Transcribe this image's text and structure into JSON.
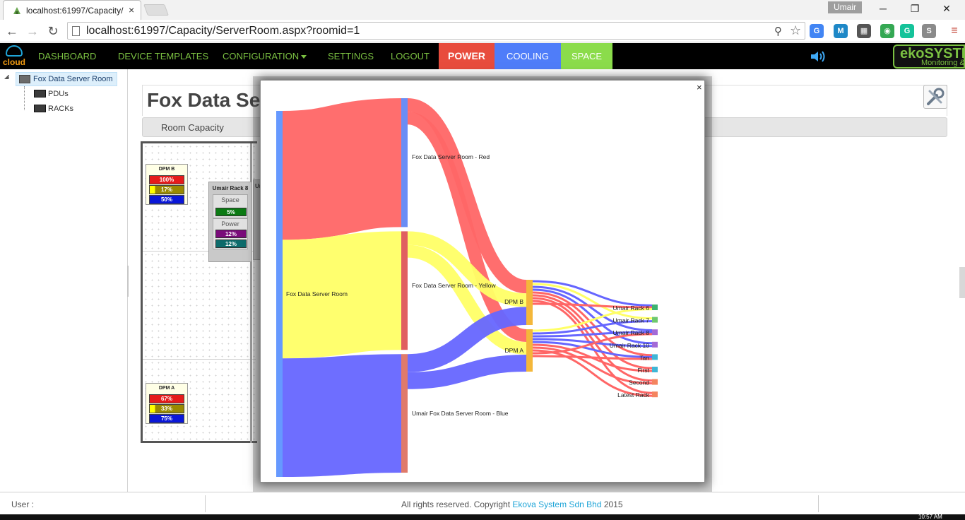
{
  "browser": {
    "tab_title": "localhost:61997/Capacity/",
    "tab_close": "×",
    "profile_name": "Umair",
    "url": "localhost:61997/Capacity/ServerRoom.aspx?roomid=1",
    "icons": [
      "back-icon",
      "forward-icon",
      "reload-icon",
      "page-icon",
      "zoom-icon",
      "star-icon",
      "menu-icon"
    ],
    "extensions": [
      {
        "name": "google-translate-extension-icon",
        "label": "G",
        "color": "#4285f4"
      },
      {
        "name": "m-extension-icon",
        "label": "M",
        "color": "#1e88c7"
      },
      {
        "name": "qr-extension-icon",
        "label": "▦",
        "color": "#555555"
      },
      {
        "name": "chrome-extension-icon",
        "label": "◉",
        "color": "#34a853"
      },
      {
        "name": "grammarly-extension-icon",
        "label": "G",
        "color": "#15c39a"
      },
      {
        "name": "skype-extension-icon",
        "label": "S",
        "color": "#8a8a8a"
      }
    ]
  },
  "nav": {
    "logo_text": "cloud",
    "items": [
      "DASHBOARD",
      "DEVICE TEMPLATES",
      "CONFIGURATION",
      "SETTINGS",
      "LOGOUT"
    ],
    "tabs": [
      {
        "label": "POWER",
        "bg": "#e84c3d",
        "fg": "#ffffff"
      },
      {
        "label": "COOLING",
        "bg": "#4f7df9",
        "fg": "#ffffff"
      },
      {
        "label": "SPACE",
        "bg": "#8bdc4b",
        "fg": "#ffffff"
      }
    ],
    "brand_name": "ekoSYSTE",
    "brand_sub": "Monitoring & Control"
  },
  "tree": {
    "root": "Fox Data Server Room",
    "children": [
      "PDUs",
      "RACKs"
    ]
  },
  "page": {
    "title": "Fox Data Se",
    "subheader": "Room Capacity"
  },
  "room": {
    "dpm_b": {
      "title": "DPM B",
      "bars": [
        {
          "label": "100%",
          "color": "#e51b1b",
          "fill": 1.0
        },
        {
          "label": "17%",
          "color": "#9a8a00",
          "fill": 0.17
        },
        {
          "label": "50%",
          "color": "#0a17d8",
          "fill": 0.5
        }
      ]
    },
    "dpm_a": {
      "title": "DPM A",
      "bars": [
        {
          "label": "67%",
          "color": "#e51b1b",
          "fill": 0.67
        },
        {
          "label": "33%",
          "color": "#9a8a00",
          "fill": 0.33
        },
        {
          "label": "75%",
          "color": "#0a17d8",
          "fill": 0.75
        }
      ]
    },
    "rack": {
      "title": "Umair Rack 8",
      "space_label": "Space",
      "space_value": "5%",
      "power_label": "Power",
      "power_values": [
        "12%",
        "12%"
      ]
    },
    "rack_partial_label": "Ur"
  },
  "modal": {
    "close": "×"
  },
  "chart_data": {
    "type": "sankey",
    "nodes": [
      "Fox Data Server Room",
      "Fox Data Server Room - Red",
      "Fox Data Server Room - Yellow",
      "Umair Fox Data Server Room - Blue",
      "DPM B",
      "DPM A",
      "Umair Rack 6",
      "Umair Rack 7",
      "Umair Rack 8",
      "Umair Rack 10",
      "Tan",
      "First",
      "Second",
      "Latest Rack"
    ],
    "colors": {
      "red": "#ff6666",
      "yellow": "#ffff66",
      "blue": "#6666ff",
      "source": "#6699ff"
    },
    "links": [
      {
        "source": "Fox Data Server Room",
        "target": "Fox Data Server Room - Red",
        "value": 50,
        "color": "red"
      },
      {
        "source": "Fox Data Server Room",
        "target": "Fox Data Server Room - Yellow",
        "value": 46,
        "color": "yellow"
      },
      {
        "source": "Fox Data Server Room",
        "target": "Umair Fox Data Server Room - Blue",
        "value": 46,
        "color": "blue"
      },
      {
        "source": "Fox Data Server Room - Red",
        "target": "DPM B",
        "value": 3,
        "color": "red"
      },
      {
        "source": "Fox Data Server Room - Red",
        "target": "DPM A",
        "value": 3,
        "color": "red"
      },
      {
        "source": "Fox Data Server Room - Yellow",
        "target": "DPM B",
        "value": 3,
        "color": "yellow"
      },
      {
        "source": "Fox Data Server Room - Yellow",
        "target": "DPM A",
        "value": 3,
        "color": "yellow"
      },
      {
        "source": "Umair Fox Data Server Room - Blue",
        "target": "DPM B",
        "value": 4,
        "color": "blue"
      },
      {
        "source": "Umair Fox Data Server Room - Blue",
        "target": "DPM A",
        "value": 4,
        "color": "blue"
      },
      {
        "source": "DPM B",
        "target": "Umair Rack 6",
        "value": 1,
        "color": "blue"
      },
      {
        "source": "DPM B",
        "target": "Umair Rack 7",
        "value": 1,
        "color": "yellow"
      },
      {
        "source": "DPM B",
        "target": "Umair Rack 8",
        "value": 1,
        "color": "blue"
      },
      {
        "source": "DPM B",
        "target": "Umair Rack 10",
        "value": 1,
        "color": "blue"
      },
      {
        "source": "DPM B",
        "target": "Tan",
        "value": 1,
        "color": "red"
      },
      {
        "source": "DPM B",
        "target": "First",
        "value": 1,
        "color": "red"
      },
      {
        "source": "DPM B",
        "target": "Second",
        "value": 1,
        "color": "red"
      },
      {
        "source": "DPM B",
        "target": "Latest Rack",
        "value": 1,
        "color": "red"
      },
      {
        "source": "DPM B",
        "target": "Umair Rack 6",
        "value": 1,
        "color": "red"
      },
      {
        "source": "DPM A",
        "target": "Umair Rack 6",
        "value": 1,
        "color": "yellow"
      },
      {
        "source": "DPM A",
        "target": "Umair Rack 7",
        "value": 1,
        "color": "blue"
      },
      {
        "source": "DPM A",
        "target": "Umair Rack 8",
        "value": 1,
        "color": "blue"
      },
      {
        "source": "DPM A",
        "target": "Umair Rack 10",
        "value": 1,
        "color": "blue"
      },
      {
        "source": "DPM A",
        "target": "Tan",
        "value": 1,
        "color": "blue"
      },
      {
        "source": "DPM A",
        "target": "First",
        "value": 1,
        "color": "red"
      },
      {
        "source": "DPM A",
        "target": "Second",
        "value": 1,
        "color": "red"
      },
      {
        "source": "DPM A",
        "target": "Latest Rack",
        "value": 1,
        "color": "red"
      },
      {
        "source": "DPM A",
        "target": "Umair Rack 8",
        "value": 1,
        "color": "red"
      },
      {
        "source": "DPM A",
        "target": "Tan",
        "value": 1,
        "color": "red"
      }
    ],
    "rack_node_colors": {
      "Umair Rack 6": "#3cb371",
      "Umair Rack 7": "#6ec96e",
      "Umair Rack 8": "#a36ad6",
      "Umair Rack 10": "#a36ad6",
      "Tan": "#3fb6d6",
      "First": "#3fb6d6",
      "Second": "#f4845f",
      "Latest Rack": "#f4845f"
    }
  },
  "footer": {
    "user_label": "User :",
    "copyright_prefix": "All rights reserved. Copyright ",
    "copyright_link": "Ekova System Sdn Bhd",
    "copyright_suffix": " 2015"
  },
  "taskbar": {
    "clock": "10:57 AM"
  }
}
